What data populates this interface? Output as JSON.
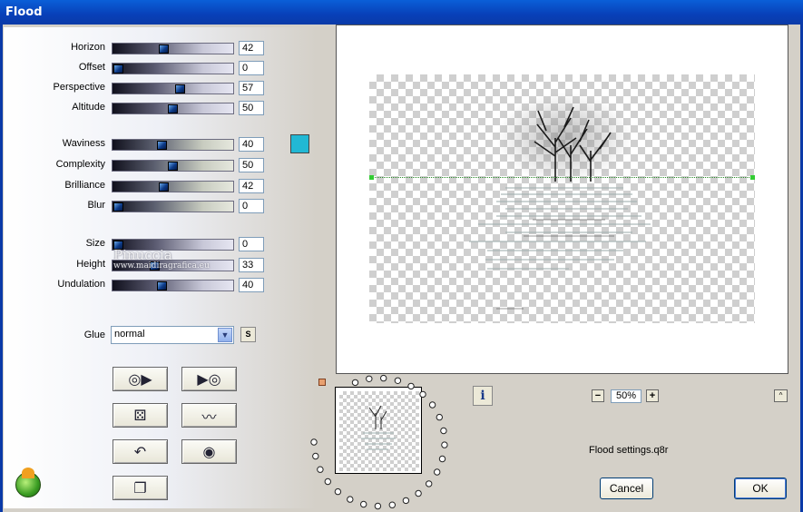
{
  "window": {
    "title": "Flood"
  },
  "sliders_group1": [
    {
      "label": "Horizon",
      "value": "42",
      "pos": 42
    },
    {
      "label": "Offset",
      "value": "0",
      "pos": 0
    },
    {
      "label": "Perspective",
      "value": "57",
      "pos": 57
    },
    {
      "label": "Altitude",
      "value": "50",
      "pos": 50
    }
  ],
  "sliders_group2": [
    {
      "label": "Waviness",
      "value": "40",
      "pos": 40
    },
    {
      "label": "Complexity",
      "value": "50",
      "pos": 50
    },
    {
      "label": "Brilliance",
      "value": "42",
      "pos": 42
    },
    {
      "label": "Blur",
      "value": "0",
      "pos": 0
    }
  ],
  "sliders_group3": [
    {
      "label": "Size",
      "value": "0",
      "pos": 0
    },
    {
      "label": "Height",
      "value": "33",
      "pos": 33
    },
    {
      "label": "Undulation",
      "value": "40",
      "pos": 40
    }
  ],
  "color_swatch": "#22b8d4",
  "glue": {
    "label": "Glue",
    "value": "normal",
    "s_button": "S"
  },
  "watermark": {
    "line1": "Pinuccia",
    "line2": "www.maidiragrafica.eu"
  },
  "preset_buttons": [
    {
      "name": "prev-preset-button",
      "icon": "prev-preset-icon",
      "glyph": "◎▶"
    },
    {
      "name": "next-preset-button",
      "icon": "next-preset-icon",
      "glyph": "▶◎"
    },
    {
      "name": "randomize-button",
      "icon": "dice-icon",
      "glyph": "⚄"
    },
    {
      "name": "wave-button",
      "icon": "wave-icon",
      "glyph": "〰"
    },
    {
      "name": "undo-button",
      "icon": "undo-icon",
      "glyph": "↶"
    },
    {
      "name": "reset-button",
      "icon": "ring-icon",
      "glyph": "◉"
    },
    {
      "name": "copy-button",
      "icon": "copy-icon",
      "glyph": "❐"
    }
  ],
  "info_button": "i",
  "zoom": {
    "value": "50%",
    "minus": "−",
    "plus": "+"
  },
  "scroll_up": "^",
  "settings_file": "Flood settings.q8r",
  "buttons": {
    "cancel": "Cancel",
    "ok": "OK"
  }
}
